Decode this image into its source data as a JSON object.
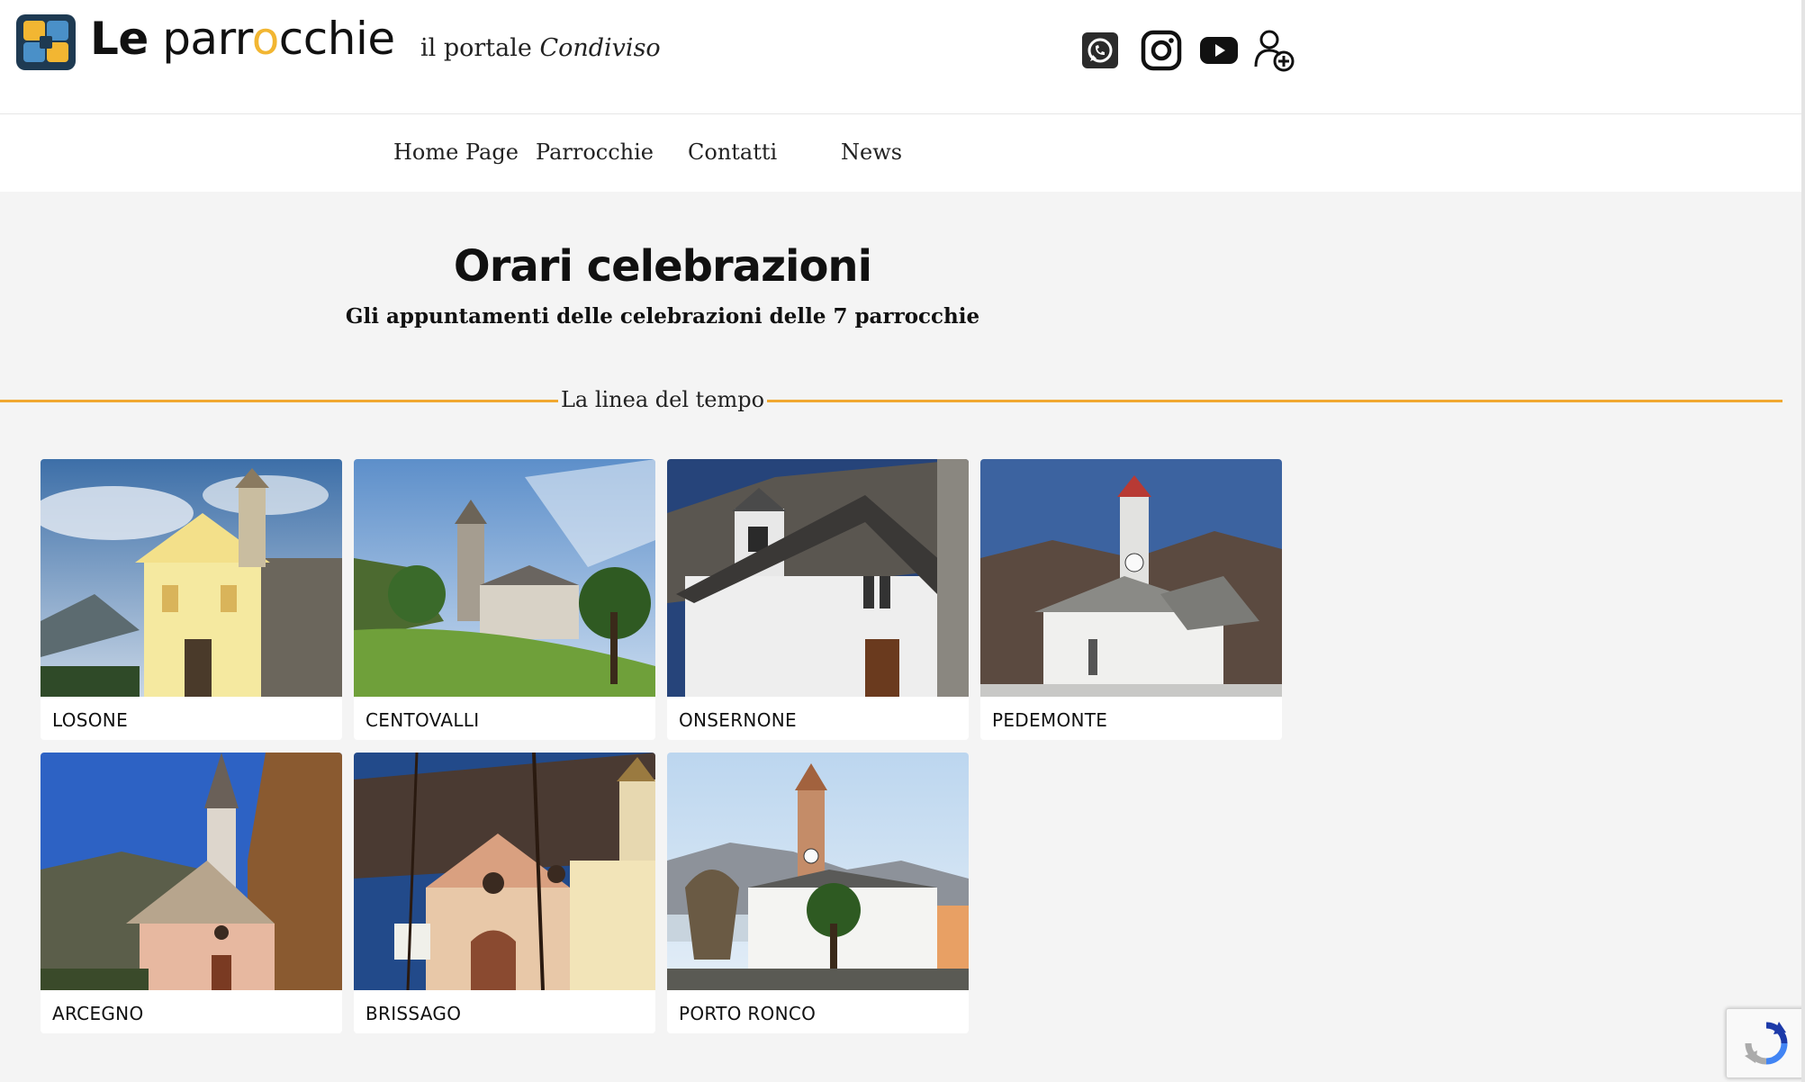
{
  "header": {
    "logo": {
      "le": "Le",
      "part1": "parr",
      "o": "o",
      "part2": "cchie"
    },
    "tagline": {
      "prefix": "il portale ",
      "emphasis": "Condiviso"
    },
    "social": [
      "whatsapp-icon",
      "instagram-icon",
      "youtube-icon",
      "user-add-icon"
    ]
  },
  "nav": {
    "items": [
      "Home Page",
      "Parrocchie",
      "Contatti",
      "News"
    ]
  },
  "main": {
    "title": "Orari celebrazioni",
    "subtitle": "Gli appuntamenti delle celebrazioni delle 7 parrocchie",
    "divider_label": "La linea del tempo"
  },
  "parishes": [
    "LOSONE",
    "CENTOVALLI",
    "ONSERNONE",
    "PEDEMONTE",
    "ARCEGNO",
    "BRISSAGO",
    "PORTO RONCO"
  ],
  "colors": {
    "accent": "#f0a830",
    "background": "#f4f4f4"
  }
}
